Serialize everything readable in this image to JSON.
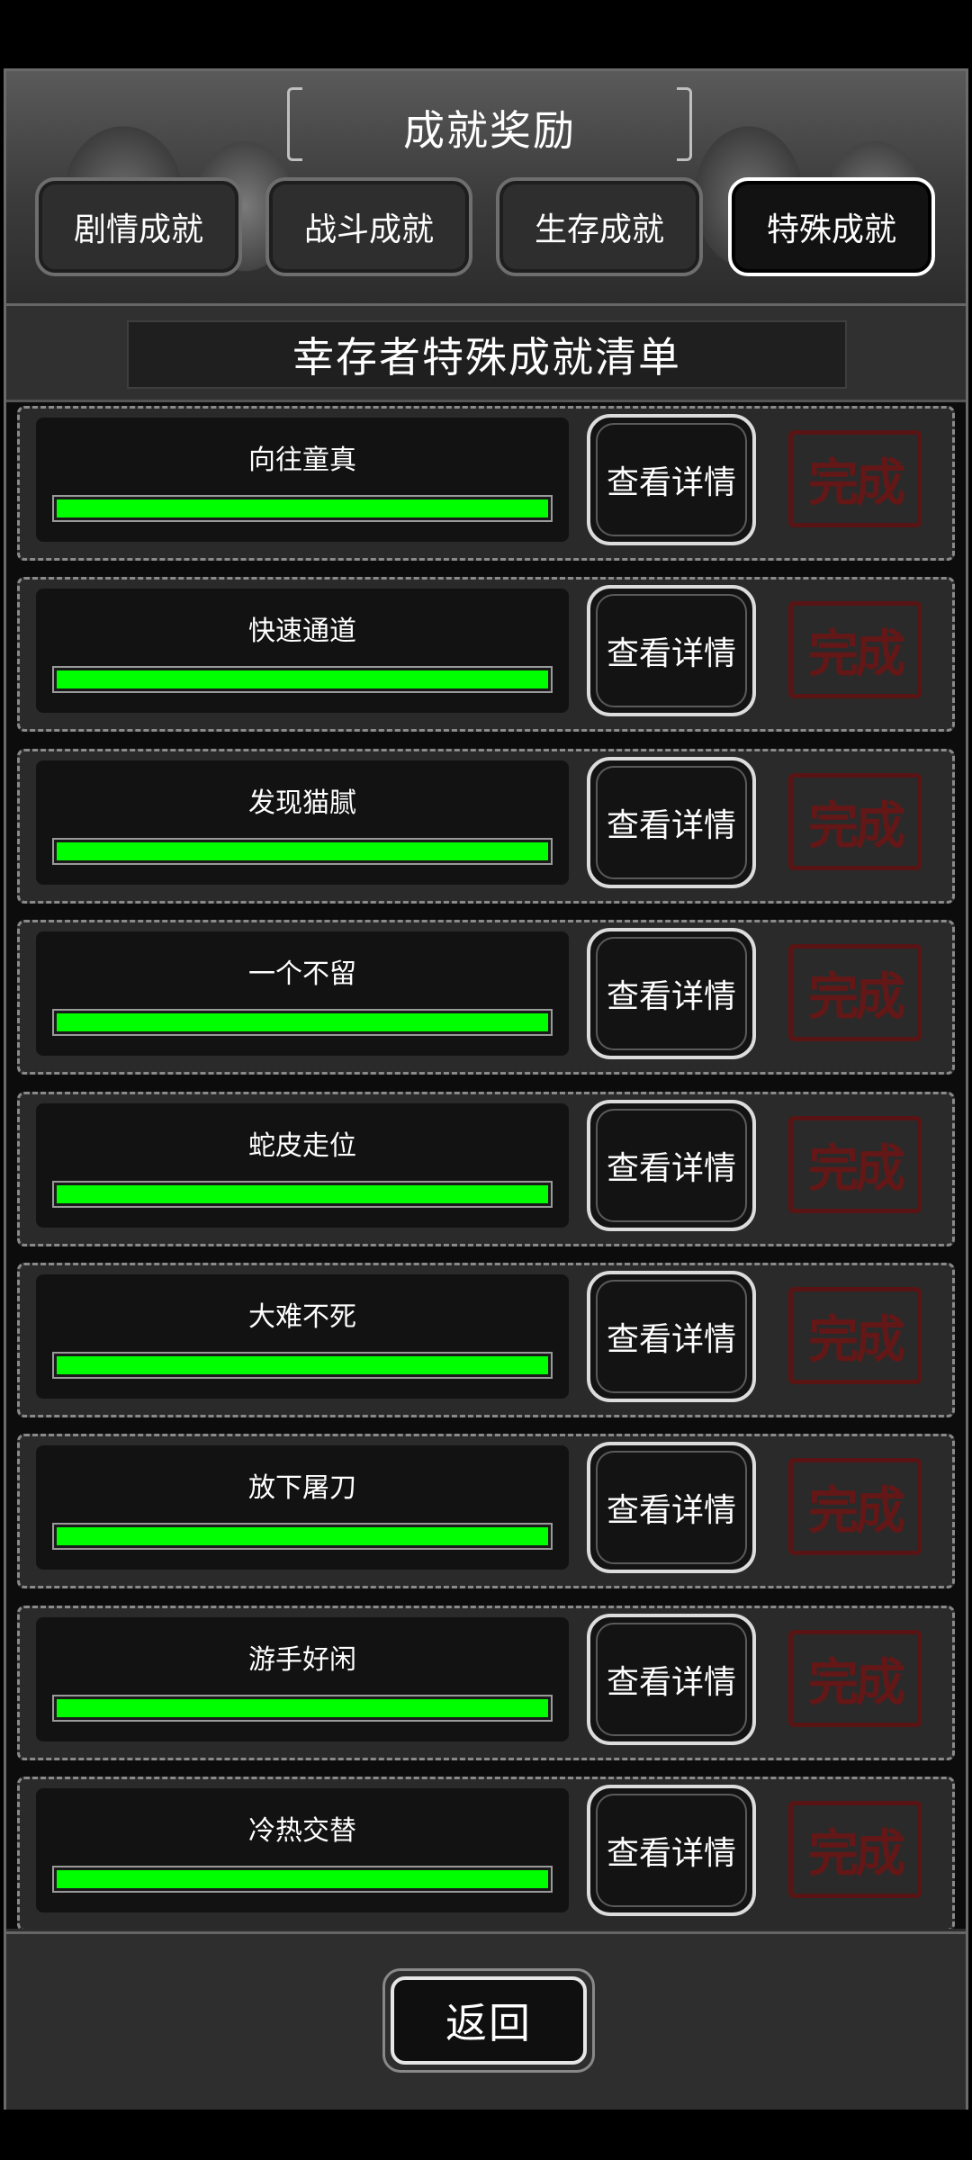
{
  "header": {
    "title": "成就奖励",
    "tabs": [
      {
        "label": "剧情成就",
        "active": false
      },
      {
        "label": "战斗成就",
        "active": false
      },
      {
        "label": "生存成就",
        "active": false
      },
      {
        "label": "特殊成就",
        "active": true
      }
    ]
  },
  "subtitle": "幸存者特殊成就清单",
  "achievements": [
    {
      "name": "向往童真",
      "progress": 1.0,
      "detail_label": "查看详情",
      "status": "完成"
    },
    {
      "name": "快速通道",
      "progress": 1.0,
      "detail_label": "查看详情",
      "status": "完成"
    },
    {
      "name": "发现猫腻",
      "progress": 1.0,
      "detail_label": "查看详情",
      "status": "完成"
    },
    {
      "name": "一个不留",
      "progress": 1.0,
      "detail_label": "查看详情",
      "status": "完成"
    },
    {
      "name": "蛇皮走位",
      "progress": 1.0,
      "detail_label": "查看详情",
      "status": "完成"
    },
    {
      "name": "大难不死",
      "progress": 1.0,
      "detail_label": "查看详情",
      "status": "完成"
    },
    {
      "name": "放下屠刀",
      "progress": 1.0,
      "detail_label": "查看详情",
      "status": "完成"
    },
    {
      "name": "游手好闲",
      "progress": 1.0,
      "detail_label": "查看详情",
      "status": "完成"
    },
    {
      "name": "冷热交替",
      "progress": 1.0,
      "detail_label": "查看详情",
      "status": "完成"
    }
  ],
  "footer": {
    "back_label": "返回"
  },
  "colors": {
    "progress_fill": "#00ff00",
    "stamp": "#6b1515",
    "active_tab_border": "#ffffff"
  }
}
